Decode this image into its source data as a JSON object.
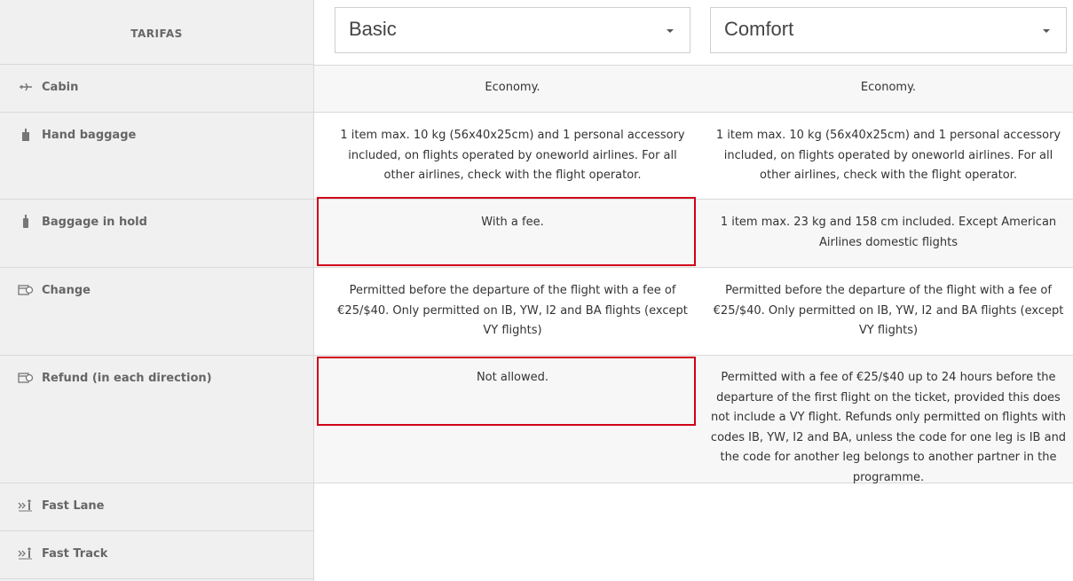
{
  "header": {
    "title": "TARIFAS"
  },
  "fares": [
    {
      "label": "Basic"
    },
    {
      "label": "Comfort"
    }
  ],
  "rows": [
    {
      "label": "Cabin",
      "icon": "airplane-icon",
      "basic": "Economy.",
      "comfort": "Economy."
    },
    {
      "label": "Hand baggage",
      "icon": "hand-baggage-icon",
      "basic": "1 item max. 10 kg (56x40x25cm) and 1 personal accessory included, on flights operated by oneworld airlines. For all other airlines, check with the flight operator.",
      "comfort": "1 item max. 10 kg (56x40x25cm) and 1 personal accessory included, on flights operated by oneworld airlines. For all other airlines, check with the flight operator."
    },
    {
      "label": "Baggage in hold",
      "icon": "hold-baggage-icon",
      "basic": "With a fee.",
      "comfort": "1 item max. 23 kg and 158 cm included. Except American Airlines domestic flights"
    },
    {
      "label": "Change",
      "icon": "calendar-change-icon",
      "basic": "Permitted before the departure of the flight with a fee of €25/$40. Only permitted on IB, YW, I2 and BA flights (except VY flights)",
      "comfort": "Permitted before the departure of the flight with a fee of €25/$40. Only permitted on IB, YW, I2 and BA flights (except VY flights)"
    },
    {
      "label": "Refund (in each direction)",
      "icon": "calendar-refund-icon",
      "basic": "Not allowed.",
      "comfort": "Permitted with a fee of €25/$40 up to 24 hours before the departure of the first flight on the ticket, provided this does not include a VY flight. Refunds only permitted on flights with codes IB, YW, I2 and BA, unless the code for one leg is IB and the code for another leg belongs to another partner in the programme."
    },
    {
      "label": "Fast Lane",
      "icon": "fast-lane-icon"
    },
    {
      "label": "Fast Track",
      "icon": "fast-track-icon"
    }
  ],
  "colors": {
    "highlight": "#d0021b",
    "label_bg": "#f0f0f0",
    "row_alt_bg": "#f7f7f7"
  }
}
